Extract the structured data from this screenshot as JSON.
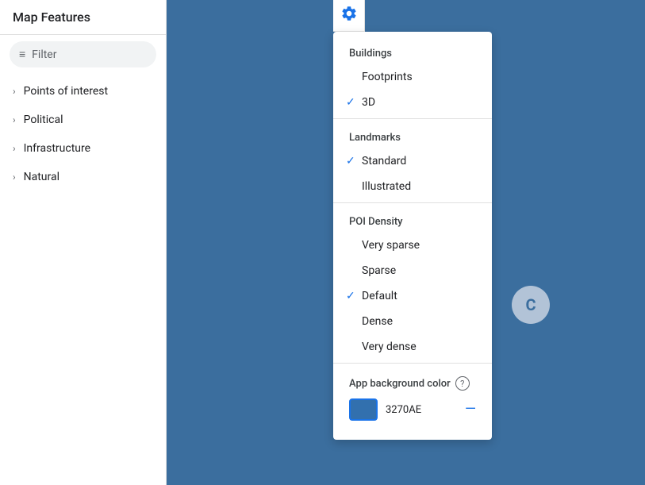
{
  "sidebar": {
    "title": "Map Features",
    "filter_placeholder": "Filter",
    "nav_items": [
      {
        "label": "Points of interest"
      },
      {
        "label": "Political"
      },
      {
        "label": "Infrastructure"
      },
      {
        "label": "Natural"
      }
    ]
  },
  "dropdown": {
    "sections": [
      {
        "title": "Buildings",
        "items": [
          {
            "label": "Footprints",
            "checked": false
          },
          {
            "label": "3D",
            "checked": true
          }
        ]
      },
      {
        "title": "Landmarks",
        "items": [
          {
            "label": "Standard",
            "checked": true
          },
          {
            "label": "Illustrated",
            "checked": false
          }
        ]
      },
      {
        "title": "POI Density",
        "items": [
          {
            "label": "Very sparse",
            "checked": false
          },
          {
            "label": "Sparse",
            "checked": false
          },
          {
            "label": "Default",
            "checked": true
          },
          {
            "label": "Dense",
            "checked": false
          },
          {
            "label": "Very dense",
            "checked": false
          }
        ]
      }
    ],
    "app_bg": {
      "label": "App background color",
      "color_hex": "#3270AE",
      "color_value": "3270AE"
    }
  },
  "spinner_letter": "C",
  "icons": {
    "gear": "⚙",
    "filter": "≡",
    "chevron": "›",
    "help": "?",
    "reset": "—"
  }
}
